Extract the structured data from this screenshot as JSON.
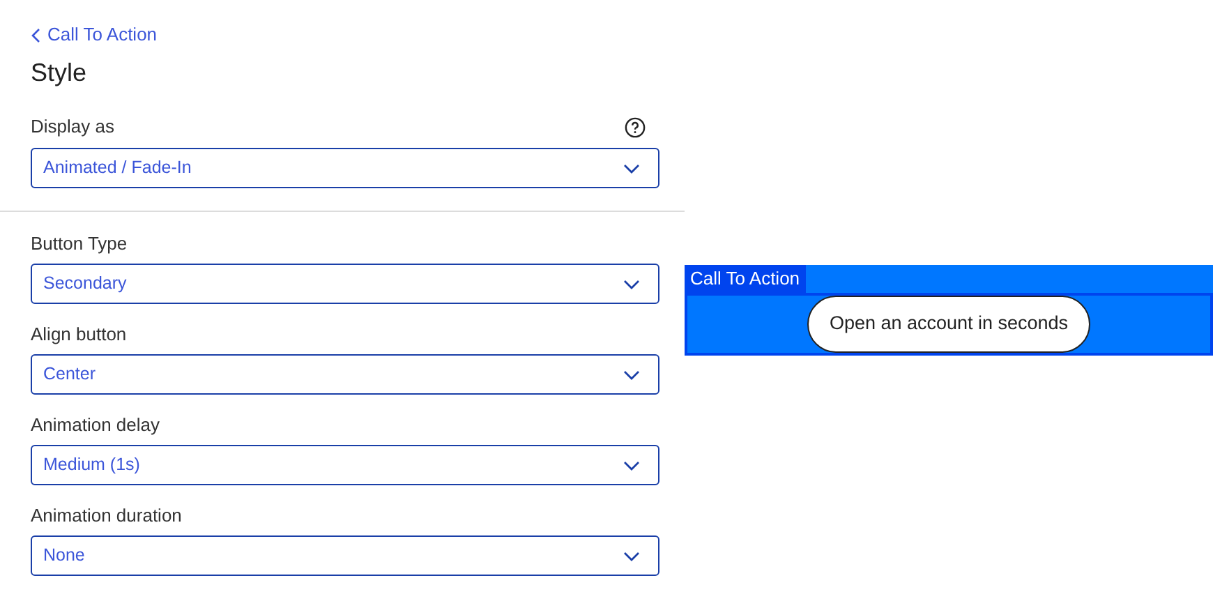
{
  "back_link": "Call To Action",
  "title": "Style",
  "display_as": {
    "label": "Display as",
    "value": "Animated / Fade-In"
  },
  "fields": [
    {
      "label": "Button Type",
      "value": "Secondary"
    },
    {
      "label": "Align button",
      "value": "Center"
    },
    {
      "label": "Animation delay",
      "value": "Medium (1s)"
    },
    {
      "label": "Animation duration",
      "value": "None"
    }
  ],
  "preview": {
    "tag": "Call To Action",
    "button": "Open an account in seconds"
  }
}
